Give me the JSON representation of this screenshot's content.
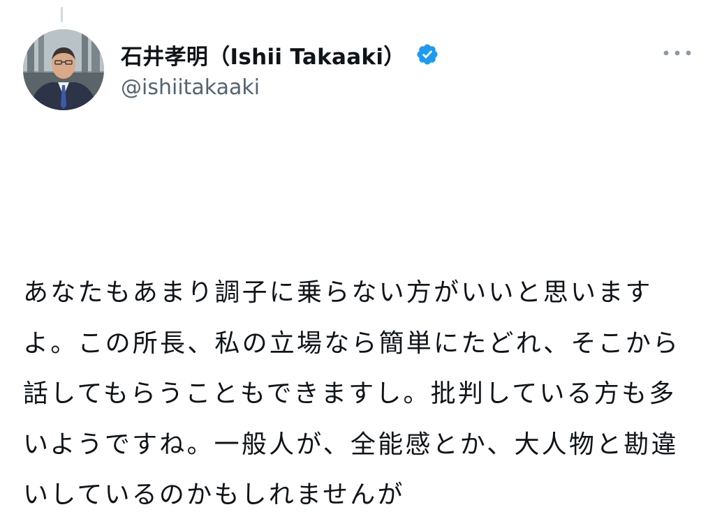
{
  "tweet": {
    "author": {
      "display_name": "石井孝明（Ishii Takaaki）",
      "handle": "@ishiitakaaki",
      "verified": true,
      "avatar_icon": "profile-photo",
      "verified_icon": "verified-badge-icon"
    },
    "more_icon": "more-options-icon",
    "text": "あなたもあまり調子に乗らない方がいいと思いますよ。この所長、私の立場なら簡単にたどれ、そこから話してもらうこともできますし。批判している方も多いようですね。一般人が、全能感とか、大人物と勘違いしているのかもしれませんが"
  },
  "colors": {
    "text": "#0f1419",
    "secondary_text": "#536471",
    "verified_blue": "#1d9bf0",
    "thread_line": "#cfd9de"
  }
}
